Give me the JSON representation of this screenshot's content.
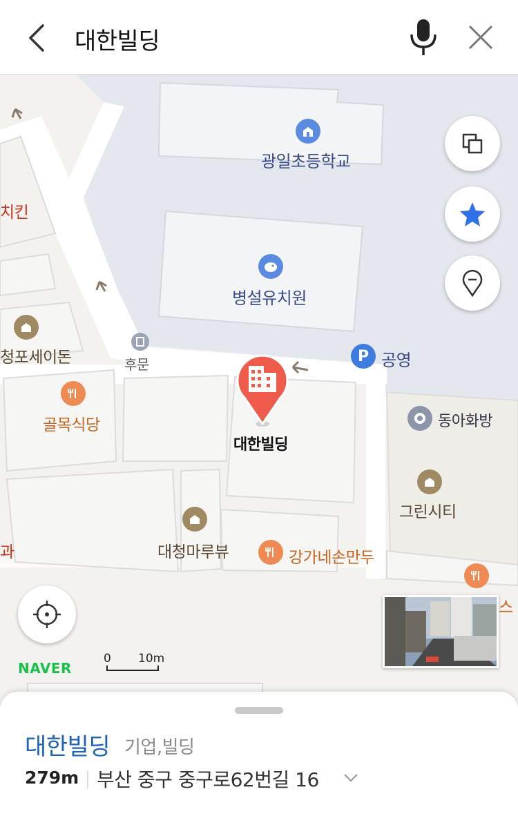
{
  "search": {
    "query": "대한빌딩",
    "back_icon": "chevron-left-icon",
    "mic_icon": "microphone-icon",
    "clear_icon": "close-icon"
  },
  "map": {
    "colors": {
      "school_area": "#e4e8ee",
      "road": "#ffffff",
      "block": "#f3f2ef",
      "building_outline": "#dcdcdc"
    },
    "labels": {
      "school": "광일초등학교",
      "kindergarten": "병설유치원",
      "chicken": "치킨",
      "cheongpo": "청포세이돈",
      "back_gate": "후문",
      "golmok": "골목식당",
      "parking": "공영",
      "selected": "대한빌딩",
      "donga": "동아화방",
      "green_city": "그린시티",
      "daecheong": "대청마루뷰",
      "ganga": "강가네손만두",
      "gwa": "과",
      "partial_s": "스"
    },
    "marker_icon": "building-marker-icon",
    "controls": {
      "layers_icon": "layers-icon",
      "favorite_icon": "star-icon",
      "location_pin_icon": "map-pin-icon",
      "my_location_icon": "crosshair-icon"
    },
    "brand": "NAVER",
    "scale": {
      "start": "0",
      "end": "10m"
    }
  },
  "place": {
    "name": "대한빌딩",
    "category": "기업,빌딩",
    "distance": "279m",
    "address": "부산 중구 중구로62번길 16"
  }
}
